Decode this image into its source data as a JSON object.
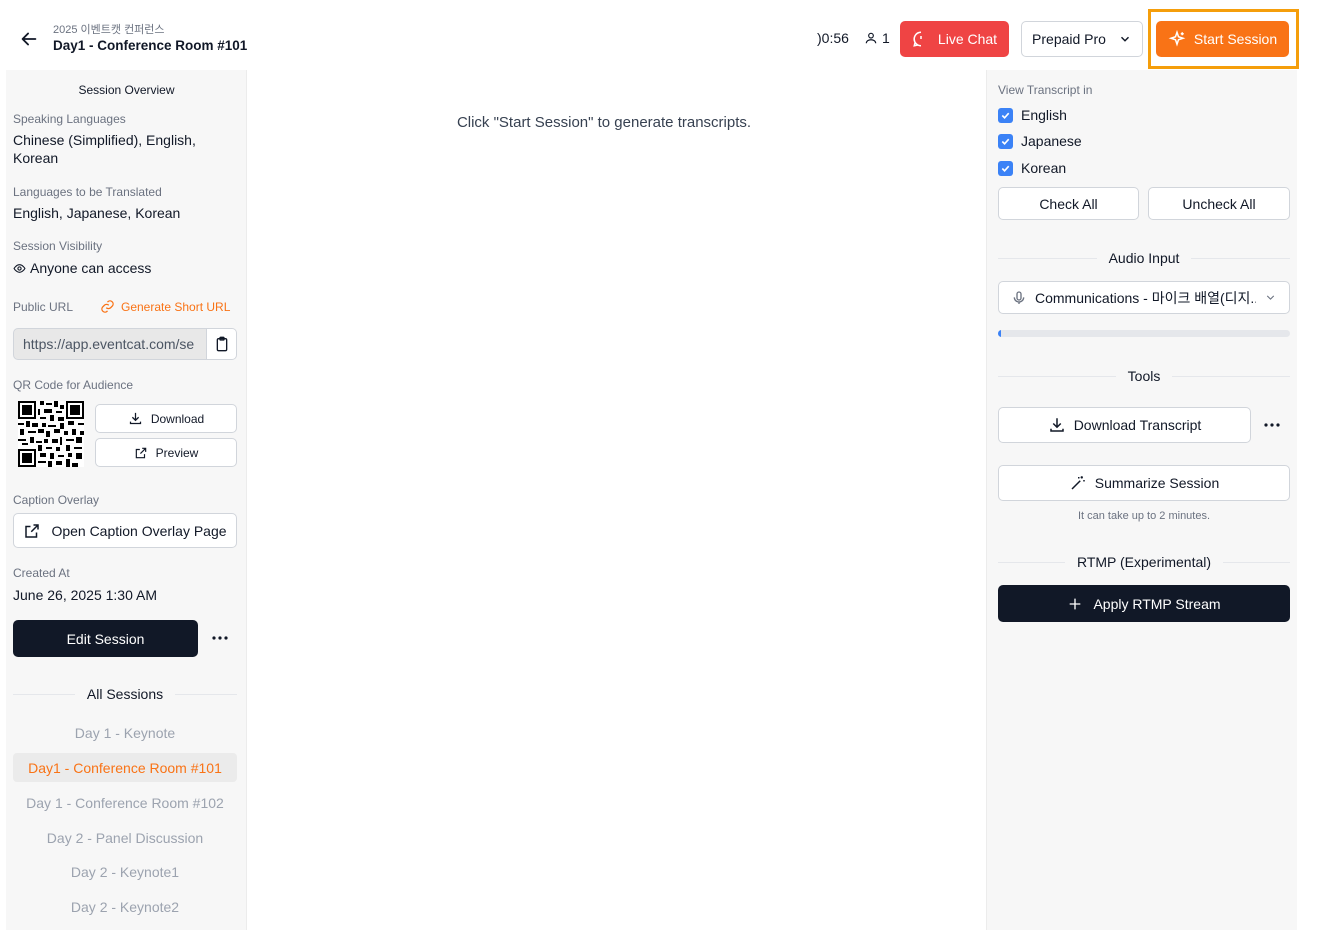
{
  "header": {
    "event_name": "2025 이벤트캣 컨퍼런스",
    "session_name": "Day1 - Conference Room #101",
    "timer": ")0:56",
    "viewer_count": "1",
    "live_chat_label": "Live Chat",
    "plan_label": "Prepaid Pro",
    "start_label": "Start Session"
  },
  "sidebar": {
    "title": "Session Overview",
    "speaking_label": "Speaking Languages",
    "speaking_value": "Chinese (Simplified), English, Korean",
    "translated_label": "Languages to be Translated",
    "translated_value": "English, Japanese, Korean",
    "visibility_label": "Session Visibility",
    "visibility_value": "Anyone can access",
    "public_url_label": "Public URL",
    "generate_short_url": "Generate Short URL",
    "public_url_value": "https://app.eventcat.com/se",
    "qr_label": "QR Code for Audience",
    "download_label": "Download",
    "preview_label": "Preview",
    "caption_label": "Caption Overlay",
    "caption_button": "Open Caption Overlay Page",
    "created_label": "Created At",
    "created_value": "June 26, 2025 1:30 AM",
    "edit_button": "Edit Session",
    "all_sessions_title": "All Sessions",
    "sessions": [
      {
        "label": "Day 1 - Keynote",
        "active": false
      },
      {
        "label": "Day1 - Conference Room #101",
        "active": true
      },
      {
        "label": "Day 1 - Conference Room #102",
        "active": false
      },
      {
        "label": "Day 2 - Panel Discussion",
        "active": false
      },
      {
        "label": "Day 2 - Keynote1",
        "active": false
      },
      {
        "label": "Day 2 - Keynote2",
        "active": false
      }
    ]
  },
  "main": {
    "empty_message": "Click \"Start Session\" to generate transcripts."
  },
  "right_panel": {
    "view_transcript_label": "View Transcript in",
    "languages": [
      {
        "label": "English",
        "checked": true
      },
      {
        "label": "Japanese",
        "checked": true
      },
      {
        "label": "Korean",
        "checked": true
      }
    ],
    "check_all": "Check All",
    "uncheck_all": "Uncheck All",
    "audio_input_title": "Audio Input",
    "audio_device": "Communications - 마이크 배열(디지...",
    "audio_level": 0.01,
    "tools_title": "Tools",
    "download_transcript": "Download Transcript",
    "summarize_session": "Summarize Session",
    "summarize_hint": "It can take up to 2 minutes.",
    "rtmp_title": "RTMP (Experimental)",
    "rtmp_button": "Apply RTMP Stream"
  },
  "colors": {
    "accent": "#f97316",
    "danger": "#ef4444",
    "highlight_frame": "#f59e0b",
    "dark_button": "#111827",
    "checkbox": "#3b82f6"
  },
  "icons": [
    "arrow-left-icon",
    "user-icon",
    "chat-icon",
    "chevron-down-icon",
    "sparkle-icon",
    "eye-icon",
    "link-icon",
    "clipboard-icon",
    "qr-code",
    "download-icon",
    "external-link-icon",
    "more-icon",
    "check-icon",
    "microphone-icon",
    "magic-wand-icon",
    "plus-icon"
  ]
}
